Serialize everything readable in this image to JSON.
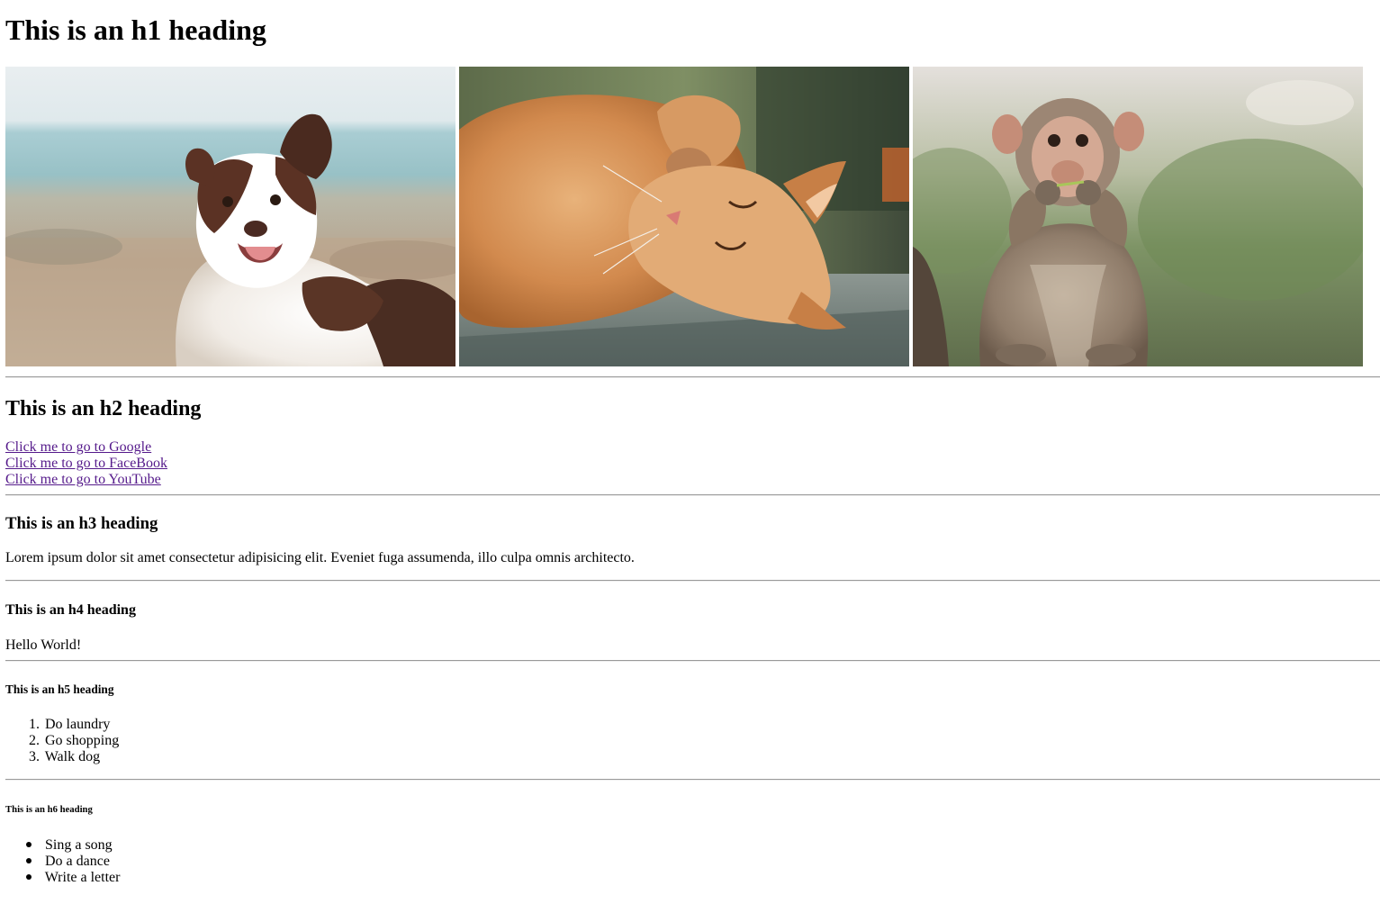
{
  "headings": {
    "h1": "This is an h1 heading",
    "h2": "This is an h2 heading",
    "h3": "This is an h3 heading",
    "h4": "This is an h4 heading",
    "h5": "This is an h5 heading",
    "h6": "This is an h6 heading"
  },
  "images": [
    {
      "subject": "dog"
    },
    {
      "subject": "cat"
    },
    {
      "subject": "monkey"
    }
  ],
  "links": [
    "Click me to go to Google",
    "Click me to go to FaceBook",
    "Click me to go to YouTube"
  ],
  "paragraph": "Lorem ipsum dolor sit amet consectetur adipisicing elit. Eveniet fuga assumenda, illo culpa omnis architecto.",
  "greeting": "Hello World!",
  "ordered_list": [
    {
      "marker": "1.",
      "text": "Do laundry"
    },
    {
      "marker": "2.",
      "text": "Go shopping"
    },
    {
      "marker": "3.",
      "text": "Walk dog"
    }
  ],
  "unordered_list": [
    "Sing a song",
    "Do a dance",
    "Write a letter"
  ],
  "colors": {
    "link_visited": "#551a8b",
    "rule": "#9a9a9a",
    "text": "#000000",
    "background": "#ffffff"
  }
}
